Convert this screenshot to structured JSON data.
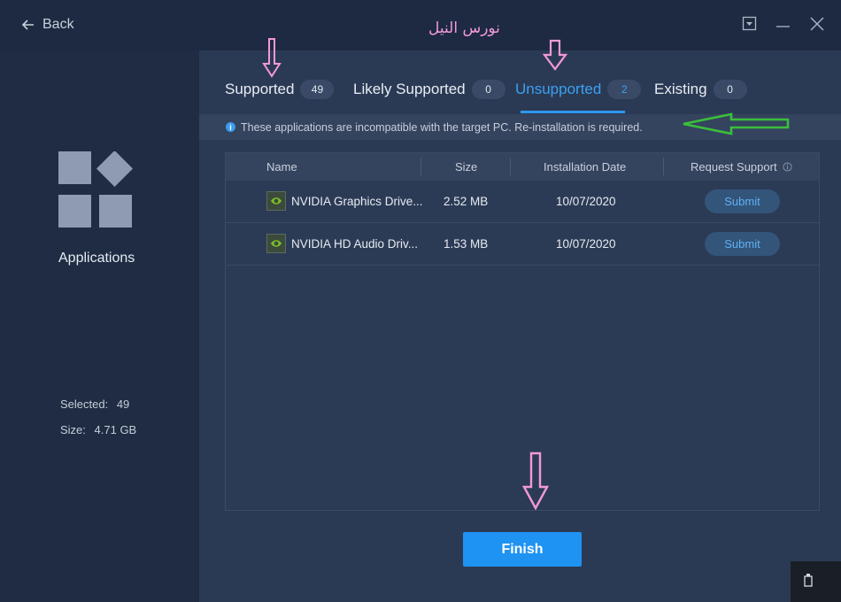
{
  "titlebar": {
    "back_label": "Back",
    "watermark": "نورس النيل"
  },
  "sidebar": {
    "app_label": "Applications",
    "selected_label": "Selected:",
    "selected_value": "49",
    "size_label": "Size:",
    "size_value": "4.71 GB"
  },
  "tabs": [
    {
      "label": "Supported",
      "count": "49"
    },
    {
      "label": "Likely Supported",
      "count": "0"
    },
    {
      "label": "Unsupported",
      "count": "2"
    },
    {
      "label": "Existing",
      "count": "0"
    }
  ],
  "info_text": "These applications are incompatible with the target PC. Re-installation is required.",
  "table": {
    "headers": [
      "Name",
      "Size",
      "Installation Date",
      "Request Support"
    ],
    "rows": [
      {
        "name": "NVIDIA Graphics Drive...",
        "size": "2.52 MB",
        "date": "10/07/2020",
        "action": "Submit"
      },
      {
        "name": "NVIDIA HD Audio Driv...",
        "size": "1.53 MB",
        "date": "10/07/2020",
        "action": "Submit"
      }
    ]
  },
  "finish_label": "Finish",
  "colors": {
    "accent": "#1e93f2",
    "annotation_pink": "#f29ad6",
    "annotation_green": "#3bbf3b"
  }
}
